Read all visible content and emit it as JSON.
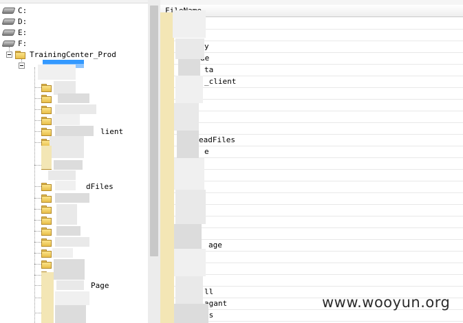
{
  "tree": {
    "drives": [
      {
        "label": "C:",
        "icon": "drive-icon"
      },
      {
        "label": "D:",
        "icon": "drive-icon"
      },
      {
        "label": "E:",
        "icon": "drive-icon"
      },
      {
        "label": "F:",
        "icon": "drive-icon"
      }
    ],
    "root_folder": "TrainingCenter_Prod",
    "partial_labels": {
      "client": "lient",
      "uploadfiles": "dFiles",
      "page": "Page"
    }
  },
  "list": {
    "header": "FileName",
    "partial_labels": [
      "y",
      "de",
      "ta",
      "_client",
      "eadFiles",
      "e",
      "age",
      "ll",
      "agant",
      "is"
    ]
  },
  "watermark": "www.wooyun.org"
}
